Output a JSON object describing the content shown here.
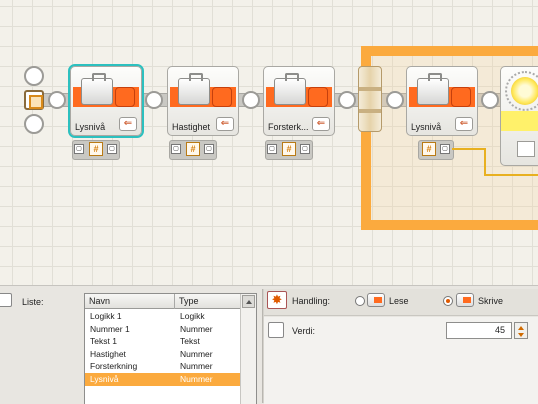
{
  "canvas": {
    "blocks": [
      {
        "label": "Lysnivå",
        "selected": true
      },
      {
        "label": "Hastighet",
        "selected": false
      },
      {
        "label": "Forsterk...",
        "selected": false
      },
      {
        "label": "Lysnivå",
        "selected": false
      }
    ],
    "hub_symbol": "#",
    "colors": {
      "accent": "#ff6a1f",
      "loop": "#fbaa3e",
      "selection": "#2cc0bf",
      "light": "#fff16a"
    }
  },
  "panel": {
    "list_label": "Liste:",
    "columns": [
      "Navn",
      "Type"
    ],
    "rows": [
      {
        "name": "Logikk 1",
        "type": "Logikk"
      },
      {
        "name": "Nummer 1",
        "type": "Nummer"
      },
      {
        "name": "Tekst 1",
        "type": "Tekst"
      },
      {
        "name": "Hastighet",
        "type": "Nummer"
      },
      {
        "name": "Forsterkning",
        "type": "Nummer"
      },
      {
        "name": "Lysnivå",
        "type": "Nummer"
      }
    ],
    "selected_row": 5,
    "action_label": "Handling:",
    "read_label": "Lese",
    "write_label": "Skrive",
    "selected_action": "Skrive",
    "value_label": "Verdi:",
    "value": "45"
  }
}
